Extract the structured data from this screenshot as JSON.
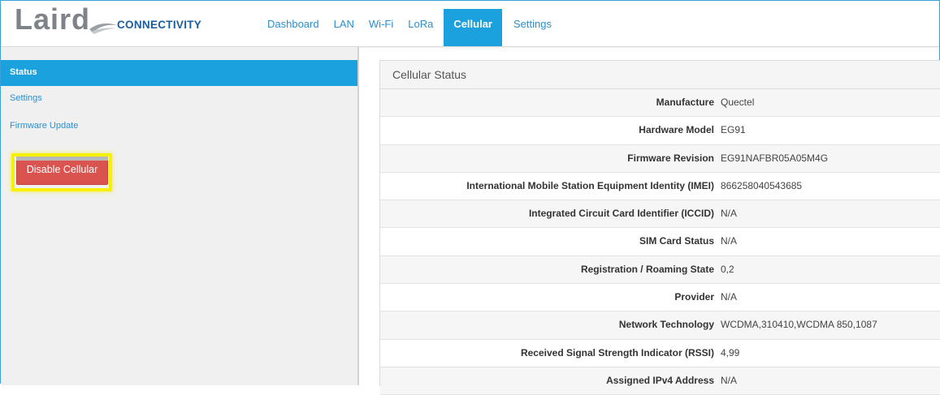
{
  "brand": {
    "name": "Laird",
    "subtitle": "CONNECTIVITY"
  },
  "nav": {
    "items": [
      {
        "label": "Dashboard",
        "active": false
      },
      {
        "label": "LAN",
        "active": false
      },
      {
        "label": "Wi-Fi",
        "active": false
      },
      {
        "label": "LoRa",
        "active": false
      },
      {
        "label": "Cellular",
        "active": true
      },
      {
        "label": "Settings",
        "active": false
      }
    ]
  },
  "sidebar": {
    "items": [
      {
        "label": "Status",
        "active": true
      },
      {
        "label": "Settings",
        "active": false
      },
      {
        "label": "Firmware Update",
        "active": false
      }
    ],
    "disable_button": "Disable Cellular"
  },
  "panel": {
    "title": "Cellular Status",
    "rows": [
      {
        "label": "Manufacture",
        "value": "Quectel"
      },
      {
        "label": "Hardware Model",
        "value": "EG91"
      },
      {
        "label": "Firmware Revision",
        "value": "EG91NAFBR05A05M4G"
      },
      {
        "label": "International Mobile Station Equipment Identity (IMEI)",
        "value": "866258040543685"
      },
      {
        "label": "Integrated Circuit Card Identifier (ICCID)",
        "value": "N/A"
      },
      {
        "label": "SIM Card Status",
        "value": "N/A"
      },
      {
        "label": "Registration / Roaming State",
        "value": "0,2"
      },
      {
        "label": "Provider",
        "value": "N/A"
      },
      {
        "label": "Network Technology",
        "value": "WCDMA,310410,WCDMA 850,1087"
      },
      {
        "label": "Received Signal Strength Indicator (RSSI)",
        "value": "4,99"
      },
      {
        "label": "Assigned IPv4 Address",
        "value": "N/A"
      }
    ]
  },
  "colors": {
    "accent": "#1ba1dd",
    "link": "#2a8fd0",
    "danger": "#d9534f",
    "highlight": "#f6f100",
    "brand_gray": "#7d8388",
    "brand_blue": "#1c5c9b"
  }
}
